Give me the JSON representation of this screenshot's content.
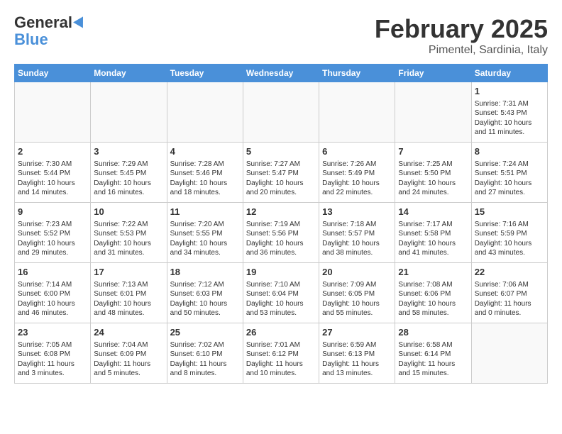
{
  "header": {
    "logo_line1": "General",
    "logo_line2": "Blue",
    "month": "February 2025",
    "location": "Pimentel, Sardinia, Italy"
  },
  "days_of_week": [
    "Sunday",
    "Monday",
    "Tuesday",
    "Wednesday",
    "Thursday",
    "Friday",
    "Saturday"
  ],
  "weeks": [
    [
      {
        "day": "",
        "info": ""
      },
      {
        "day": "",
        "info": ""
      },
      {
        "day": "",
        "info": ""
      },
      {
        "day": "",
        "info": ""
      },
      {
        "day": "",
        "info": ""
      },
      {
        "day": "",
        "info": ""
      },
      {
        "day": "1",
        "info": "Sunrise: 7:31 AM\nSunset: 5:43 PM\nDaylight: 10 hours\nand 11 minutes."
      }
    ],
    [
      {
        "day": "2",
        "info": "Sunrise: 7:30 AM\nSunset: 5:44 PM\nDaylight: 10 hours\nand 14 minutes."
      },
      {
        "day": "3",
        "info": "Sunrise: 7:29 AM\nSunset: 5:45 PM\nDaylight: 10 hours\nand 16 minutes."
      },
      {
        "day": "4",
        "info": "Sunrise: 7:28 AM\nSunset: 5:46 PM\nDaylight: 10 hours\nand 18 minutes."
      },
      {
        "day": "5",
        "info": "Sunrise: 7:27 AM\nSunset: 5:47 PM\nDaylight: 10 hours\nand 20 minutes."
      },
      {
        "day": "6",
        "info": "Sunrise: 7:26 AM\nSunset: 5:49 PM\nDaylight: 10 hours\nand 22 minutes."
      },
      {
        "day": "7",
        "info": "Sunrise: 7:25 AM\nSunset: 5:50 PM\nDaylight: 10 hours\nand 24 minutes."
      },
      {
        "day": "8",
        "info": "Sunrise: 7:24 AM\nSunset: 5:51 PM\nDaylight: 10 hours\nand 27 minutes."
      }
    ],
    [
      {
        "day": "9",
        "info": "Sunrise: 7:23 AM\nSunset: 5:52 PM\nDaylight: 10 hours\nand 29 minutes."
      },
      {
        "day": "10",
        "info": "Sunrise: 7:22 AM\nSunset: 5:53 PM\nDaylight: 10 hours\nand 31 minutes."
      },
      {
        "day": "11",
        "info": "Sunrise: 7:20 AM\nSunset: 5:55 PM\nDaylight: 10 hours\nand 34 minutes."
      },
      {
        "day": "12",
        "info": "Sunrise: 7:19 AM\nSunset: 5:56 PM\nDaylight: 10 hours\nand 36 minutes."
      },
      {
        "day": "13",
        "info": "Sunrise: 7:18 AM\nSunset: 5:57 PM\nDaylight: 10 hours\nand 38 minutes."
      },
      {
        "day": "14",
        "info": "Sunrise: 7:17 AM\nSunset: 5:58 PM\nDaylight: 10 hours\nand 41 minutes."
      },
      {
        "day": "15",
        "info": "Sunrise: 7:16 AM\nSunset: 5:59 PM\nDaylight: 10 hours\nand 43 minutes."
      }
    ],
    [
      {
        "day": "16",
        "info": "Sunrise: 7:14 AM\nSunset: 6:00 PM\nDaylight: 10 hours\nand 46 minutes."
      },
      {
        "day": "17",
        "info": "Sunrise: 7:13 AM\nSunset: 6:01 PM\nDaylight: 10 hours\nand 48 minutes."
      },
      {
        "day": "18",
        "info": "Sunrise: 7:12 AM\nSunset: 6:03 PM\nDaylight: 10 hours\nand 50 minutes."
      },
      {
        "day": "19",
        "info": "Sunrise: 7:10 AM\nSunset: 6:04 PM\nDaylight: 10 hours\nand 53 minutes."
      },
      {
        "day": "20",
        "info": "Sunrise: 7:09 AM\nSunset: 6:05 PM\nDaylight: 10 hours\nand 55 minutes."
      },
      {
        "day": "21",
        "info": "Sunrise: 7:08 AM\nSunset: 6:06 PM\nDaylight: 10 hours\nand 58 minutes."
      },
      {
        "day": "22",
        "info": "Sunrise: 7:06 AM\nSunset: 6:07 PM\nDaylight: 11 hours\nand 0 minutes."
      }
    ],
    [
      {
        "day": "23",
        "info": "Sunrise: 7:05 AM\nSunset: 6:08 PM\nDaylight: 11 hours\nand 3 minutes."
      },
      {
        "day": "24",
        "info": "Sunrise: 7:04 AM\nSunset: 6:09 PM\nDaylight: 11 hours\nand 5 minutes."
      },
      {
        "day": "25",
        "info": "Sunrise: 7:02 AM\nSunset: 6:10 PM\nDaylight: 11 hours\nand 8 minutes."
      },
      {
        "day": "26",
        "info": "Sunrise: 7:01 AM\nSunset: 6:12 PM\nDaylight: 11 hours\nand 10 minutes."
      },
      {
        "day": "27",
        "info": "Sunrise: 6:59 AM\nSunset: 6:13 PM\nDaylight: 11 hours\nand 13 minutes."
      },
      {
        "day": "28",
        "info": "Sunrise: 6:58 AM\nSunset: 6:14 PM\nDaylight: 11 hours\nand 15 minutes."
      },
      {
        "day": "",
        "info": ""
      }
    ]
  ]
}
